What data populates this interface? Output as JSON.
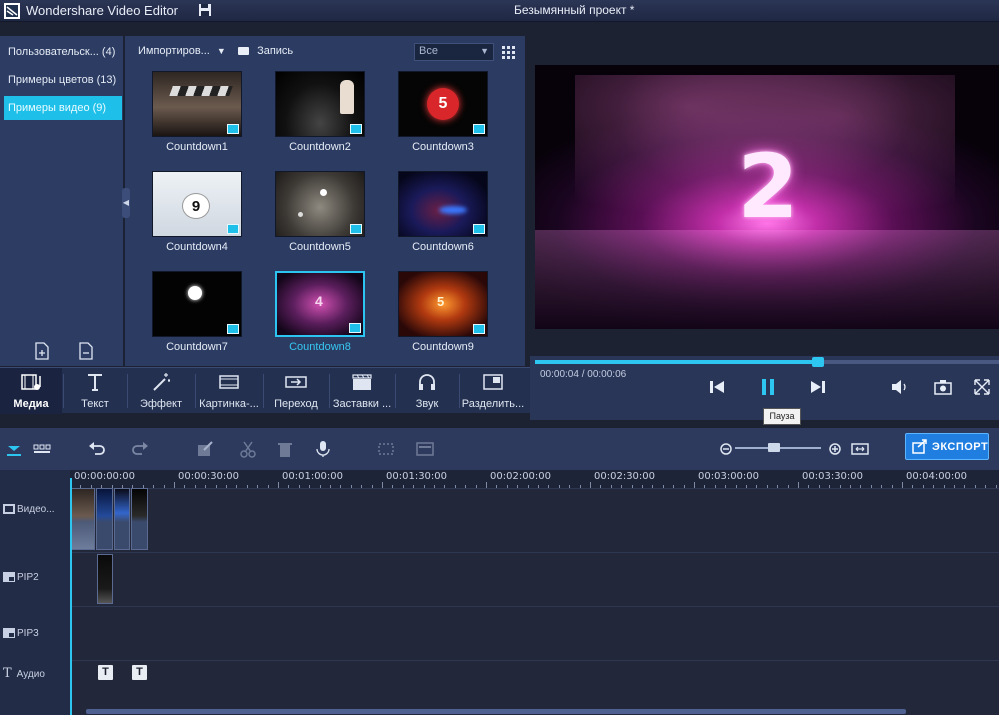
{
  "window": {
    "app_title": "Wondershare Video Editor",
    "project_title": "Безымянный проект *"
  },
  "categories": [
    {
      "label": "Пользовательск... (4)"
    },
    {
      "label": "Примеры цветов (13)"
    },
    {
      "label": "Примеры видео (9)"
    }
  ],
  "media_toolbar": {
    "import_label": "Импортиров...",
    "record_label": "Запись",
    "filter_value": "Все"
  },
  "media_items": [
    {
      "label": "Countdown1"
    },
    {
      "label": "Countdown2"
    },
    {
      "label": "Countdown3"
    },
    {
      "label": "Countdown4"
    },
    {
      "label": "Countdown5"
    },
    {
      "label": "Countdown6"
    },
    {
      "label": "Countdown7"
    },
    {
      "label": "Countdown8"
    },
    {
      "label": "Countdown9"
    }
  ],
  "modes": [
    {
      "label": "Медиа"
    },
    {
      "label": "Текст"
    },
    {
      "label": "Эффект"
    },
    {
      "label": "Картинка-..."
    },
    {
      "label": "Переход"
    },
    {
      "label": "Заставки ..."
    },
    {
      "label": "Звук"
    },
    {
      "label": "Разделить..."
    }
  ],
  "preview": {
    "timecode": "00:00:04 / 00:00:06",
    "progress": 0.61,
    "tooltip": "Пауза",
    "frame_number": "2"
  },
  "timeline": {
    "export_label": "ЭКСПОРТ",
    "ruler": [
      "00:00:00:00",
      "00:00:30:00",
      "00:01:00:00",
      "00:01:30:00",
      "00:02:00:00",
      "00:02:30:00",
      "00:03:00:00",
      "00:03:30:00",
      "00:04:00:00"
    ],
    "tracks": [
      {
        "name": "Видео..."
      },
      {
        "name": "PIP2"
      },
      {
        "name": "PIP3"
      },
      {
        "name": "Аудио"
      }
    ],
    "text_clip_glyph": "T"
  },
  "colors": {
    "accent": "#1ec0ea",
    "export": "#1f7ee0",
    "panel": "#2b3b62"
  }
}
